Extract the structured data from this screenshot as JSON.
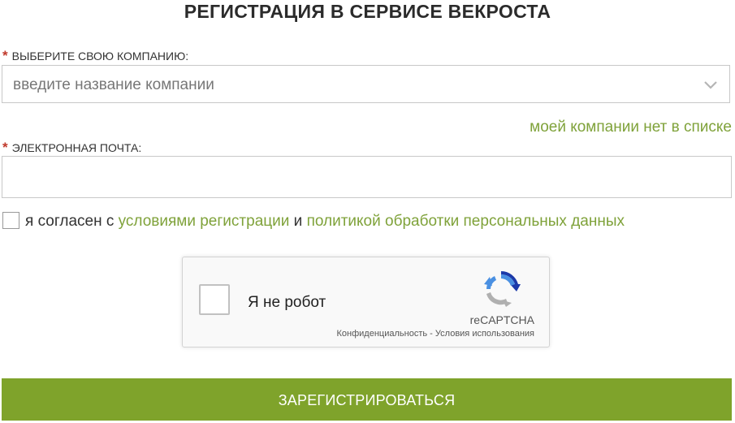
{
  "page": {
    "title": "РЕГИСТРАЦИЯ В СЕРВИСЕ ВЕКРОСТА"
  },
  "company_field": {
    "required_mark": "*",
    "label": "ВЫБЕРИТЕ СВОЮ КОМПАНИЮ:",
    "placeholder": "введите название компании",
    "icon": "chevron-down-icon"
  },
  "no_company_link": "моей компании нет в списке",
  "email_field": {
    "required_mark": "*",
    "label": "ЭЛЕКТРОННАЯ ПОЧТА:",
    "value": ""
  },
  "agreement": {
    "checked": false,
    "prefix": "я согласен с",
    "terms_link": "условиями регистрации",
    "conjunction": "и",
    "privacy_link": "политикой обработки персональных данных"
  },
  "recaptcha": {
    "checked": false,
    "label": "Я не робот",
    "brand": "reCAPTCHA",
    "privacy_link": "Конфиденциальность",
    "separator": "-",
    "terms_link": "Условия использования",
    "icon": "recaptcha-logo-icon"
  },
  "submit": {
    "label": "ЗАРЕГИСТРИРОВАТЬСЯ"
  },
  "colors": {
    "accent": "#7fa32b",
    "link": "#7fa23a",
    "required": "#c0392b"
  }
}
